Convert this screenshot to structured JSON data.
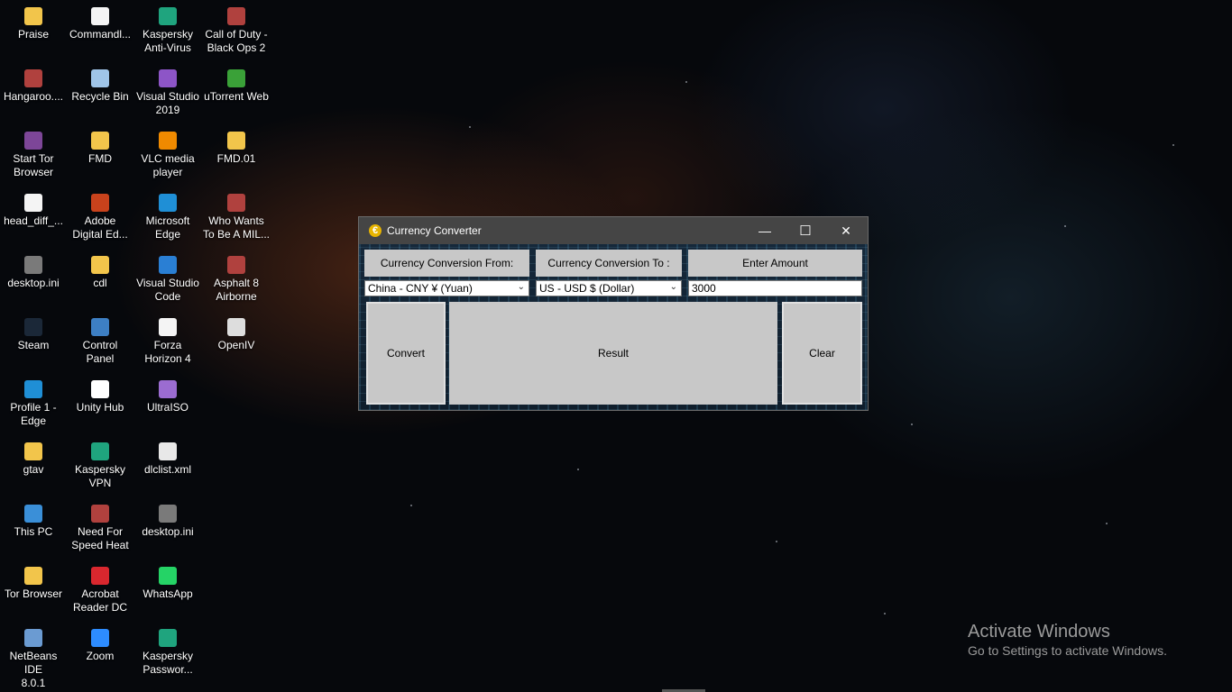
{
  "desktop": {
    "icons": [
      {
        "label": "Praise",
        "icon": "folder-icon"
      },
      {
        "label": "Hangaroo....",
        "icon": "game-icon"
      },
      {
        "label": "Start Tor\nBrowser",
        "icon": "tor-icon"
      },
      {
        "label": "head_diff_...",
        "icon": "file-icon"
      },
      {
        "label": "desktop.ini",
        "icon": "ini-file-icon"
      },
      {
        "label": "Steam",
        "icon": "steam-icon"
      },
      {
        "label": "Profile 1 -\nEdge",
        "icon": "edge-icon"
      },
      {
        "label": "gtav",
        "icon": "folder-icon"
      },
      {
        "label": "This PC",
        "icon": "computer-icon"
      },
      {
        "label": "Tor Browser",
        "icon": "folder-icon"
      },
      {
        "label": "NetBeans IDE\n8.0.1",
        "icon": "netbeans-icon"
      },
      {
        "label": "Commandl...",
        "icon": "file-icon"
      },
      {
        "label": "Recycle Bin",
        "icon": "recycle-bin-icon"
      },
      {
        "label": "FMD",
        "icon": "folder-icon"
      },
      {
        "label": "Adobe\nDigital Ed...",
        "icon": "adobe-icon"
      },
      {
        "label": "cdl",
        "icon": "folder-icon"
      },
      {
        "label": "Control\nPanel",
        "icon": "control-panel-icon"
      },
      {
        "label": "Unity Hub",
        "icon": "unity-icon"
      },
      {
        "label": "Kaspersky\nVPN",
        "icon": "kaspersky-icon"
      },
      {
        "label": "Need For\nSpeed Heat",
        "icon": "game-icon"
      },
      {
        "label": "Acrobat\nReader DC",
        "icon": "acrobat-icon"
      },
      {
        "label": "Zoom",
        "icon": "zoom-icon"
      },
      {
        "label": "Kaspersky\nAnti-Virus",
        "icon": "kaspersky-icon"
      },
      {
        "label": "Visual Studio\n2019",
        "icon": "visual-studio-icon"
      },
      {
        "label": "VLC media\nplayer",
        "icon": "vlc-icon"
      },
      {
        "label": "Microsoft\nEdge",
        "icon": "edge-icon"
      },
      {
        "label": "Visual Studio\nCode",
        "icon": "vscode-icon"
      },
      {
        "label": "Forza\nHorizon 4",
        "icon": "file-icon"
      },
      {
        "label": "UltraISO",
        "icon": "disc-icon"
      },
      {
        "label": "dlclist.xml",
        "icon": "xml-file-icon"
      },
      {
        "label": "desktop.ini",
        "icon": "ini-file-icon"
      },
      {
        "label": "WhatsApp",
        "icon": "whatsapp-icon"
      },
      {
        "label": "Kaspersky\nPasswor...",
        "icon": "kaspersky-icon"
      },
      {
        "label": "Call of Duty -\nBlack Ops 2",
        "icon": "game-icon"
      },
      {
        "label": "uTorrent Web",
        "icon": "utorrent-icon"
      },
      {
        "label": "FMD.01",
        "icon": "folder-icon"
      },
      {
        "label": "Who Wants\nTo Be A MIL...",
        "icon": "game-icon"
      },
      {
        "label": "Asphalt 8\nAirborne",
        "icon": "game-icon"
      },
      {
        "label": "OpenIV",
        "icon": "openiv-icon"
      }
    ]
  },
  "window": {
    "title": "Currency Converter",
    "icon": "euro-icon",
    "controls": {
      "minimize": "—",
      "maximize": "☐",
      "close": "✕"
    }
  },
  "form": {
    "from_label": "Currency Conversion From:",
    "to_label": "Currency Conversion To :",
    "amount_label": "Enter Amount",
    "from_value": "China - CNY ¥ (Yuan)",
    "to_value": "US - USD $ (Dollar)",
    "amount_value": "3000",
    "convert_label": "Convert",
    "result_label": "Result",
    "clear_label": "Clear"
  },
  "watermark": {
    "line1": "Activate Windows",
    "line2": "Go to Settings to activate Windows."
  }
}
